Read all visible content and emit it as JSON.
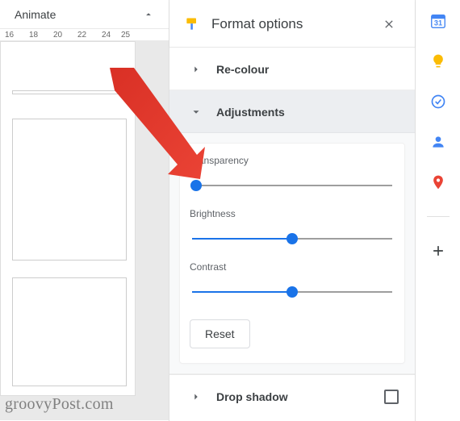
{
  "left": {
    "animate_label": "Animate",
    "ruler_ticks": [
      "16",
      "18",
      "20",
      "22",
      "24",
      "25"
    ]
  },
  "format": {
    "title": "Format options",
    "sections": {
      "recolour": {
        "label": "Re-colour"
      },
      "adjustments": {
        "label": "Adjustments",
        "transparency": {
          "label": "Transparency",
          "value": 0
        },
        "brightness": {
          "label": "Brightness",
          "value": 50
        },
        "contrast": {
          "label": "Contrast",
          "value": 50
        },
        "reset_label": "Reset"
      },
      "dropshadow": {
        "label": "Drop shadow"
      }
    }
  },
  "watermark": "groovyPost.com"
}
